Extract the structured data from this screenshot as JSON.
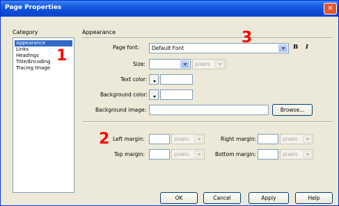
{
  "window": {
    "title": "Page Properties",
    "close_glyph": "✕"
  },
  "category": {
    "label": "Category",
    "items": [
      {
        "label": "Appearance",
        "selected": true
      },
      {
        "label": "Links"
      },
      {
        "label": "Headings"
      },
      {
        "label": "Title/Encoding"
      },
      {
        "label": "Tracing Image"
      }
    ]
  },
  "appearance": {
    "section_label": "Appearance",
    "page_font": {
      "label": "Page font:",
      "value": "Default Font"
    },
    "bold_label": "B",
    "italic_label": "I",
    "size": {
      "label": "Size:",
      "value": "",
      "unit": "pixels"
    },
    "text_color": {
      "label": "Text color:",
      "value": ""
    },
    "background_color": {
      "label": "Background color:",
      "value": ""
    },
    "background_image": {
      "label": "Background image:",
      "value": "",
      "browse_label": "Browse..."
    },
    "left_margin": {
      "label": "Left margin:",
      "value": "",
      "unit": "pixels"
    },
    "right_margin": {
      "label": "Right margin:",
      "value": "",
      "unit": "pixels"
    },
    "top_margin": {
      "label": "Top margin:",
      "value": "",
      "unit": "pixels"
    },
    "bottom_margin": {
      "label": "Bottom margin:",
      "value": "",
      "unit": "pixels"
    }
  },
  "buttons": {
    "ok": "OK",
    "cancel": "Cancel",
    "apply": "Apply",
    "help": "Help"
  },
  "annotations": {
    "one": "1",
    "two": "2",
    "three": "3"
  },
  "colors": {
    "titlebar": "#0a4bd6",
    "selection": "#316ac5",
    "annotation": "#ff0000",
    "close": "#e3562f"
  }
}
